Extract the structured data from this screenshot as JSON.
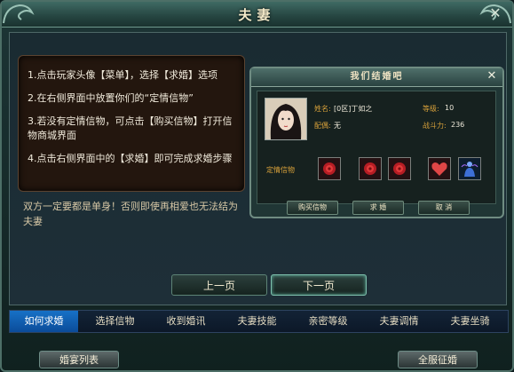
{
  "window": {
    "title": "夫妻"
  },
  "steps": [
    "1.点击玩家头像【菜单】，选择【求婚】选项",
    "2.在右侧界面中放置你们的“定情信物”",
    "3.若没有定情信物，可点击【购买信物】打开信物商城界面",
    "4.点击右侧界面中的【求婚】即可完成求婚步骤"
  ],
  "warning": "双方一定要都是单身！否则即使再相爱也无法结为夫妻",
  "dialog": {
    "title": "我们结婚吧",
    "name_label": "姓名:",
    "name_value": "[0区]丁如之",
    "level_label": "等级:",
    "level_value": "10",
    "spouse_label": "配偶:",
    "spouse_value": "无",
    "power_label": "战斗力:",
    "power_value": "236",
    "token_label": "定情信物",
    "buttons": {
      "buy": "购买信物",
      "propose": "求 婚",
      "cancel": "取 消"
    }
  },
  "pager": {
    "prev": "上一页",
    "next": "下一页"
  },
  "tabs": [
    "如何求婚",
    "选择信物",
    "收到婚讯",
    "夫妻技能",
    "亲密等级",
    "夫妻调情",
    "夫妻坐骑"
  ],
  "active_tab": "如何求婚",
  "footer": {
    "left": "婚宴列表",
    "right": "全服征婚"
  },
  "colors": {
    "active_tab": "#1771c6",
    "label_gold": "#d8a13a",
    "panel_border": "#4d6f67"
  },
  "icons": [
    "close-icon",
    "avatar-portrait",
    "red-rose-token-icon",
    "heart-token-icon",
    "spirit-token-icon"
  ]
}
